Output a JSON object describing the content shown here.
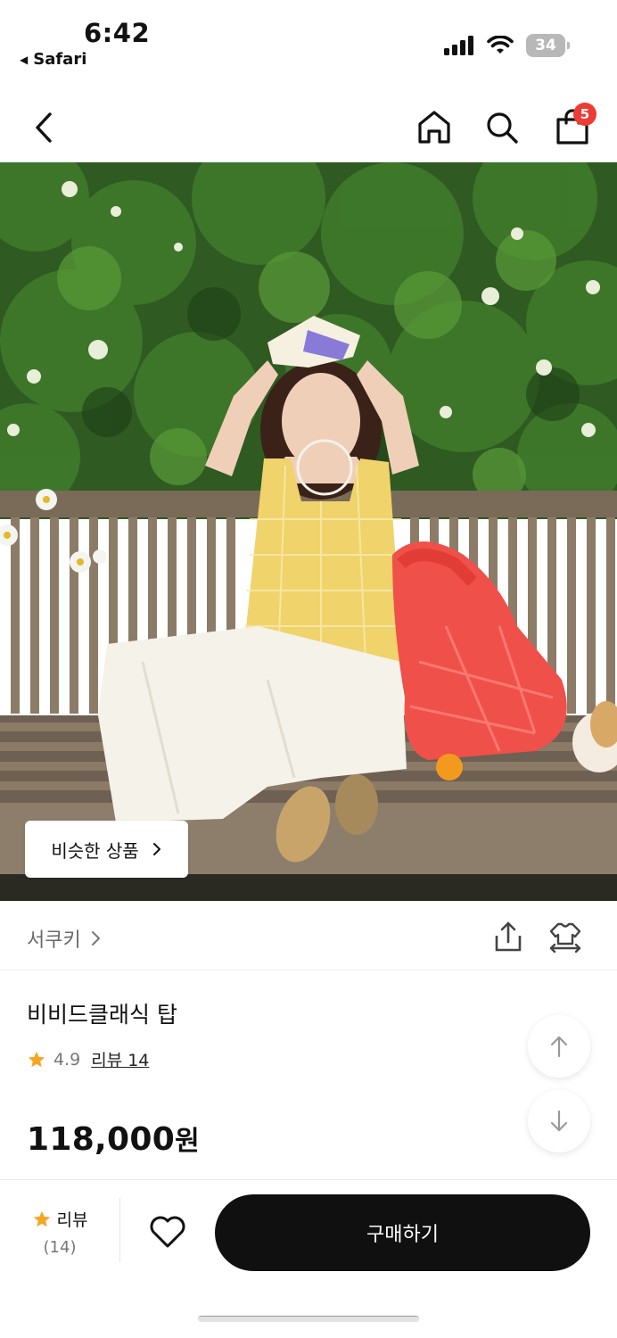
{
  "status_bar": {
    "time": "6:42",
    "back_app": "Safari",
    "battery": "34",
    "icons": [
      "signal-icon",
      "wifi-icon",
      "battery-icon"
    ]
  },
  "nav": {
    "cart_badge": "5",
    "icons": [
      "back-arrow-icon",
      "home-icon",
      "search-icon",
      "shopping-bag-icon"
    ]
  },
  "hero": {
    "similar_products_label": "비슷한 상품",
    "similar_products_chevron": "›"
  },
  "brand": {
    "name": "서쿠키",
    "chevron": "›"
  },
  "product": {
    "title": "비비드클래식 탑",
    "rating": "4.9",
    "review_link": "리뷰 14",
    "price": "118,000",
    "currency": "원"
  },
  "bottom_bar": {
    "review_label": "리뷰",
    "review_count": "(14)",
    "buy_label": "구매하기"
  },
  "colors": {
    "accent_badge": "#ee3b36",
    "star": "#f5a623",
    "buy_button": "#101010"
  }
}
